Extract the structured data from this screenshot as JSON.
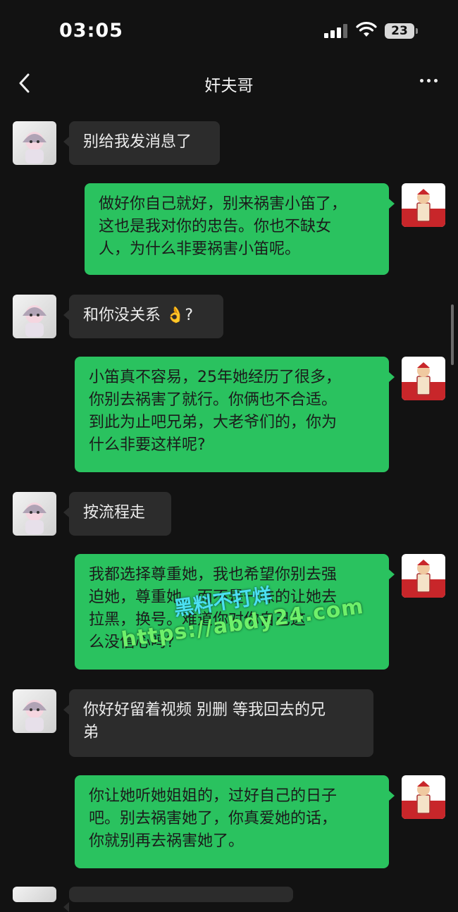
{
  "status_bar": {
    "time": "03:05",
    "battery": "23"
  },
  "nav": {
    "title": "奸夫哥"
  },
  "messages": [
    {
      "side": "left",
      "text": "别给我发消息了"
    },
    {
      "side": "right",
      "text": "做好你自己就好，别来祸害小笛了，\n这也是我对你的忠告。你也不缺女\n人，为什么非要祸害小笛呢。"
    },
    {
      "side": "left",
      "text": "和你没关系 👌?"
    },
    {
      "side": "right",
      "text": "小笛真不容易，25年她经历了很多，\n你别去祸害了就行。你俩也不合适。\n到此为止吧兄弟，大老爷们的，你为\n什么非要这样呢?"
    },
    {
      "side": "left",
      "text": "按流程走"
    },
    {
      "side": "right",
      "text": "我都选择尊重她，我也希望你别去强\n迫她，尊重她，而不是一味的让她去\n拉黑，换号。难道你对你自己这\n么没信心吗?"
    },
    {
      "side": "left",
      "text": "你好好留着视频 别删 等我回去的兄\n弟"
    },
    {
      "side": "right",
      "text": "你让她听她姐姐的，过好自己的日子\n吧。别去祸害她了，你真爱她的话，\n你就别再去祸害她了。"
    }
  ],
  "watermark": {
    "line1": "黑料不打烊",
    "line2": "https://abdy24.com"
  },
  "colors": {
    "background": "#121212",
    "outgoing_bubble": "#2ac25f",
    "incoming_bubble": "#2c2c2c"
  },
  "icons": [
    "back-chevron-icon",
    "more-dots-icon",
    "signal-icon",
    "wifi-icon",
    "battery-icon"
  ]
}
